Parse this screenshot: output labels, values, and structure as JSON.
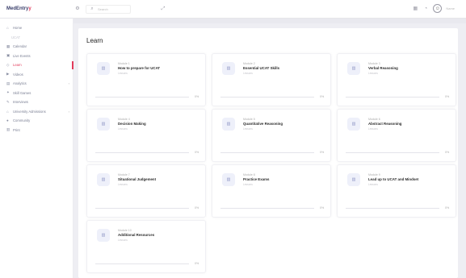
{
  "app": {
    "logo_text": "MedEntry",
    "logo_accent": "y"
  },
  "topbar": {
    "search_placeholder": "Search",
    "user_name": "Name"
  },
  "sidebar": {
    "items": [
      {
        "label": "Home",
        "icon": "⌂",
        "state": "normal"
      },
      {
        "label": "UCAT",
        "icon": "",
        "state": "muted"
      },
      {
        "label": "Calendar",
        "icon": "▦",
        "state": "normal"
      },
      {
        "label": "Live Events",
        "icon": "▣",
        "state": "normal"
      },
      {
        "label": "Learn",
        "icon": "◇",
        "state": "active"
      },
      {
        "label": "Videos",
        "icon": "▶",
        "state": "normal"
      },
      {
        "label": "Analytics",
        "icon": "▤",
        "state": "normal",
        "chev": "›"
      },
      {
        "label": "Skill Games",
        "icon": "✦",
        "state": "normal"
      },
      {
        "label": "Interviews",
        "icon": "✎",
        "state": "normal"
      },
      {
        "label": "University Admissions",
        "icon": "⌂",
        "state": "normal",
        "chev": "›"
      },
      {
        "label": "Community",
        "icon": "●",
        "state": "normal"
      },
      {
        "label": "Print",
        "icon": "▥",
        "state": "normal"
      }
    ]
  },
  "main": {
    "title": "Learn",
    "cards": [
      {
        "label": "Module 1",
        "name": "How to prepare for UCAT",
        "meta": "Lessons",
        "pct": "0%"
      },
      {
        "label": "Module 2",
        "name": "Essential UCAT Skills",
        "meta": "Lessons",
        "pct": "0%"
      },
      {
        "label": "Module 3",
        "name": "Verbal Reasoning",
        "meta": "Lessons",
        "pct": "0%"
      },
      {
        "label": "Module 4",
        "name": "Decision Making",
        "meta": "Lessons",
        "pct": "0%"
      },
      {
        "label": "Module 5",
        "name": "Quantitative Reasoning",
        "meta": "Lessons",
        "pct": "0%"
      },
      {
        "label": "Module 6",
        "name": "Abstract Reasoning",
        "meta": "Lessons",
        "pct": "0%"
      },
      {
        "label": "Module 7",
        "name": "Situational Judgement",
        "meta": "Lessons",
        "pct": "0%"
      },
      {
        "label": "Module 8",
        "name": "Practice Exams",
        "meta": "Lessons",
        "pct": "0%"
      },
      {
        "label": "Module 9",
        "name": "Lead up to UCAT and Mindset",
        "meta": "Lessons",
        "pct": "0%"
      },
      {
        "label": "Module 10",
        "name": "Additional Resources",
        "meta": "Lessons",
        "pct": "0%"
      }
    ]
  }
}
